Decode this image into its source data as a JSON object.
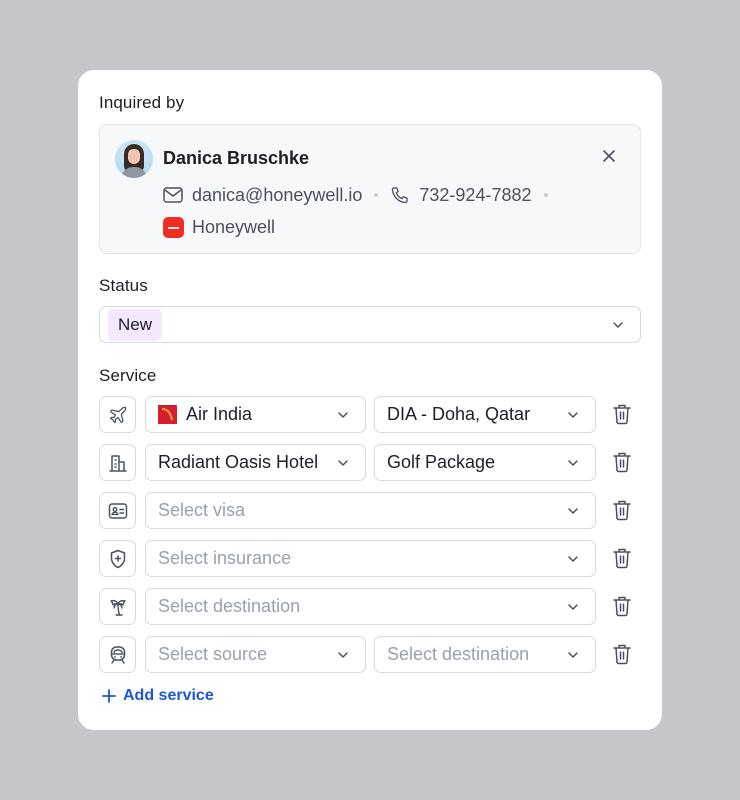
{
  "inquired_by": {
    "label": "Inquired by",
    "contact": {
      "name": "Danica Bruschke",
      "email": "danica@honeywell.io",
      "phone": "732-924-7882",
      "company": "Honeywell"
    }
  },
  "status": {
    "label": "Status",
    "value": "New",
    "badge_color": "#f3e8fd"
  },
  "service": {
    "label": "Service",
    "rows": [
      {
        "icon": "plane-icon",
        "primary": {
          "value": "Air India",
          "placeholder": ""
        },
        "secondary": {
          "value": "DIA - Doha, Qatar",
          "placeholder": ""
        }
      },
      {
        "icon": "building-icon",
        "primary": {
          "value": "Radiant Oasis Hotel",
          "placeholder": ""
        },
        "secondary": {
          "value": "Golf Package",
          "placeholder": ""
        }
      },
      {
        "icon": "id-card-icon",
        "primary": {
          "value": "",
          "placeholder": "Select visa"
        }
      },
      {
        "icon": "shield-plus-icon",
        "primary": {
          "value": "",
          "placeholder": "Select insurance"
        }
      },
      {
        "icon": "palm-tree-icon",
        "primary": {
          "value": "",
          "placeholder": "Select destination"
        }
      },
      {
        "icon": "train-icon",
        "primary": {
          "value": "",
          "placeholder": "Select source"
        },
        "secondary": {
          "value": "",
          "placeholder": "Select destination"
        }
      }
    ],
    "add_label": "Add service"
  },
  "colors": {
    "accent": "#1f56d6",
    "company_logo": "#ee2e24",
    "airline_logo": "#d51f30"
  }
}
